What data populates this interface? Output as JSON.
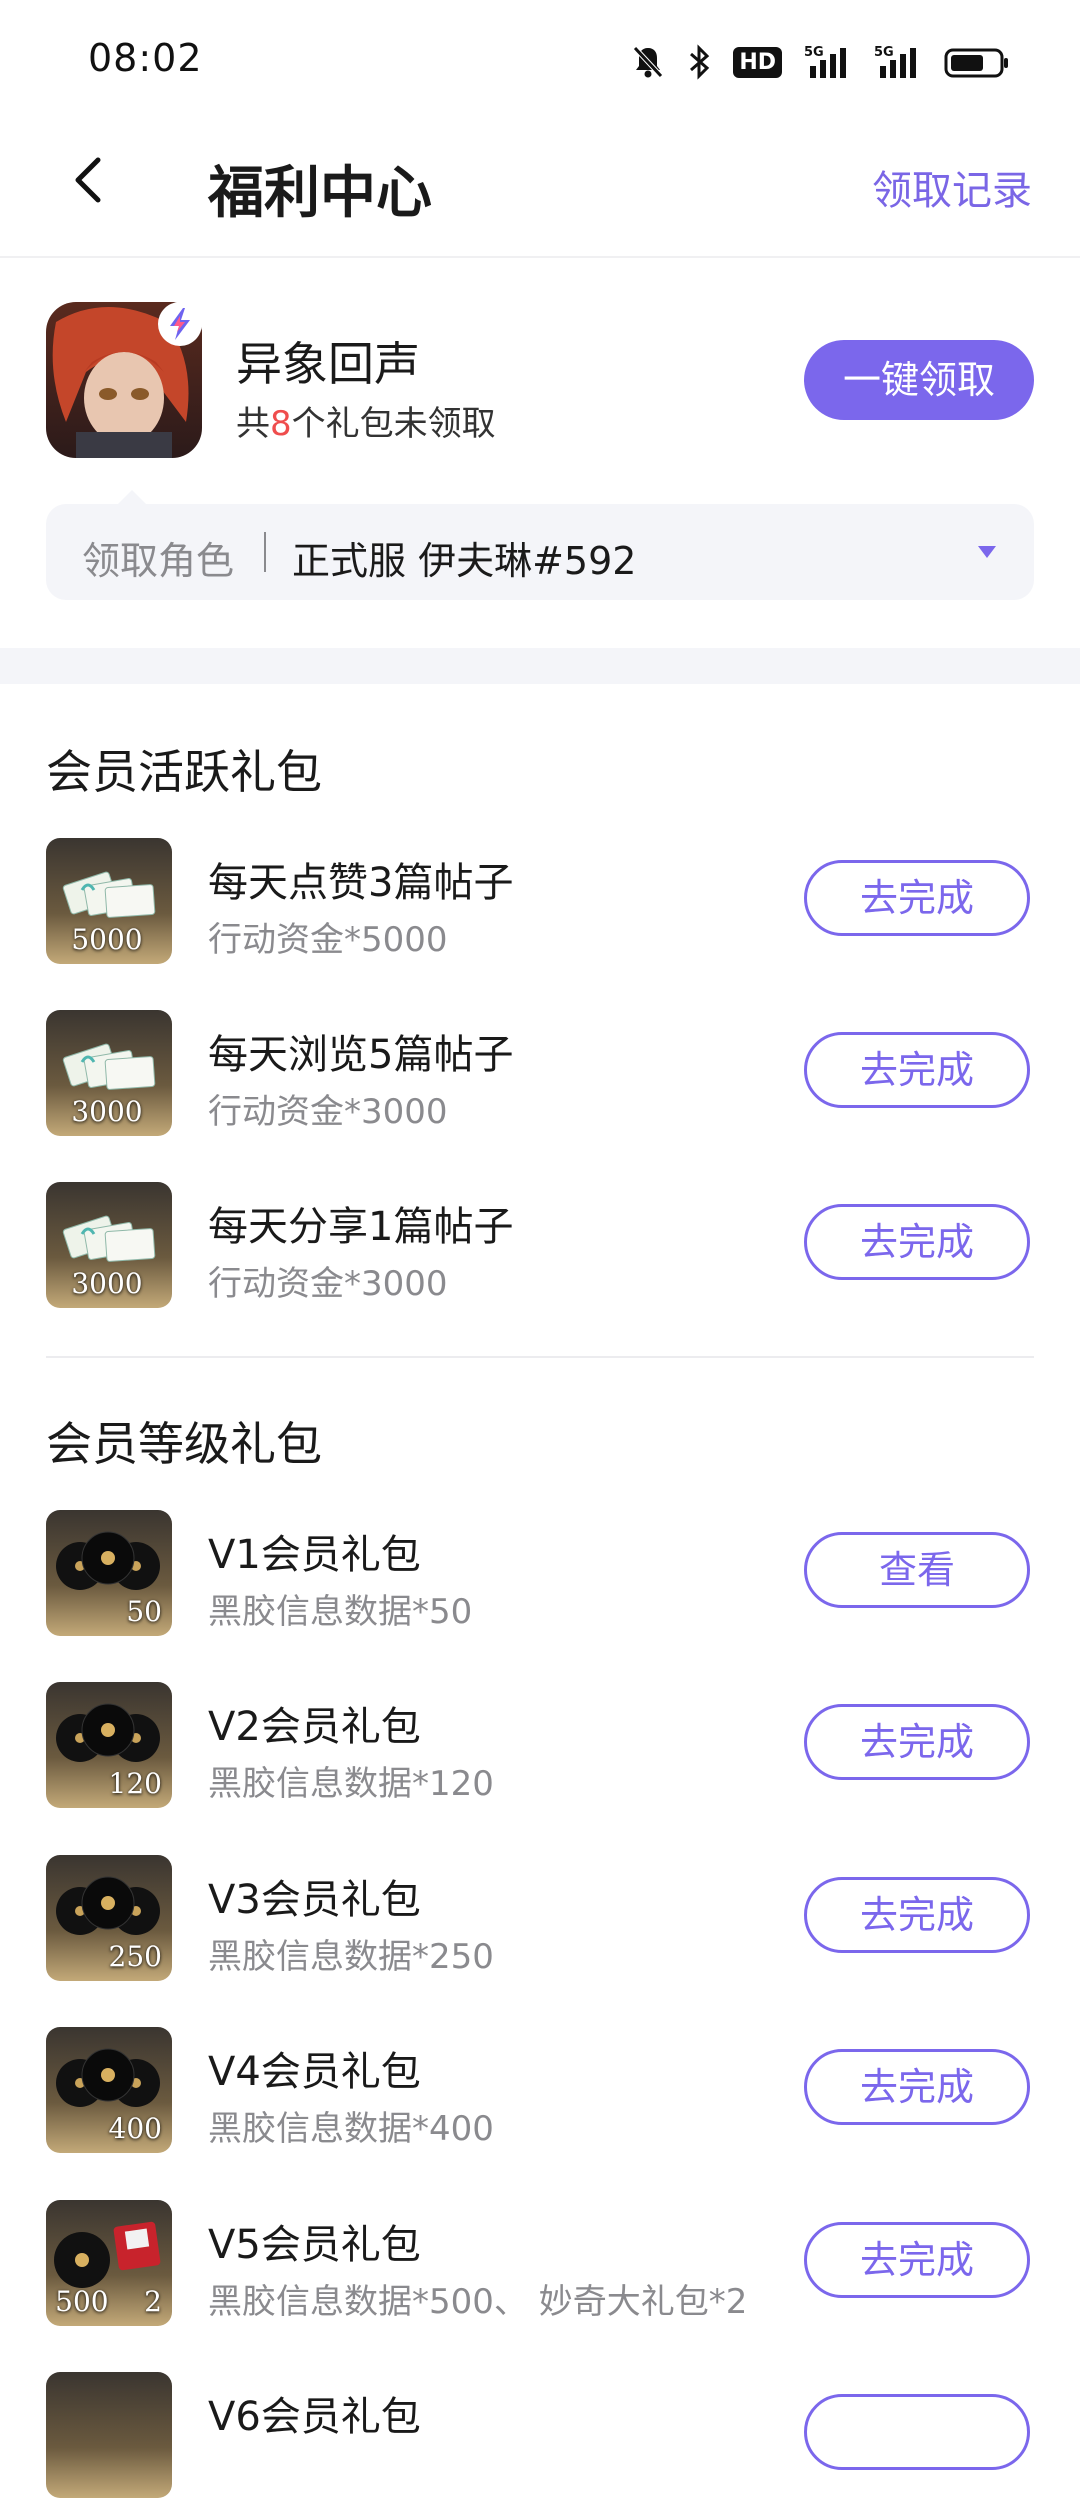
{
  "status": {
    "time": "08:02",
    "hd": "HD",
    "net1": "5G",
    "net2": "5G"
  },
  "nav": {
    "title": "福利中心",
    "link": "领取记录"
  },
  "game": {
    "name": "异象回声",
    "sub_prefix": "共",
    "sub_count": "8",
    "sub_suffix": "个礼包未领取",
    "claim_all": "一键领取"
  },
  "role": {
    "label": "领取角色",
    "value": "正式服 伊夫琳#592"
  },
  "sections": {
    "active": {
      "title": "会员活跃礼包",
      "items": [
        {
          "title": "每天点赞3篇帖子",
          "reward": "行动资金*5000",
          "qty": "5000",
          "button": "去完成"
        },
        {
          "title": "每天浏览5篇帖子",
          "reward": "行动资金*3000",
          "qty": "3000",
          "button": "去完成"
        },
        {
          "title": "每天分享1篇帖子",
          "reward": "行动资金*3000",
          "qty": "3000",
          "button": "去完成"
        }
      ]
    },
    "level": {
      "title": "会员等级礼包",
      "items": [
        {
          "title": "V1会员礼包",
          "reward": "黑胶信息数据*50",
          "qty": "50",
          "button": "查看"
        },
        {
          "title": "V2会员礼包",
          "reward": "黑胶信息数据*120",
          "qty": "120",
          "button": "去完成"
        },
        {
          "title": "V3会员礼包",
          "reward": "黑胶信息数据*250",
          "qty": "250",
          "button": "去完成"
        },
        {
          "title": "V4会员礼包",
          "reward": "黑胶信息数据*400",
          "qty": "400",
          "button": "去完成"
        },
        {
          "title": "V5会员礼包",
          "reward": "黑胶信息数据*500、 妙奇大礼包*2",
          "qty": "500    2",
          "button": "去完成"
        },
        {
          "title": "V6会员礼包",
          "reward": "",
          "qty": "",
          "button": ""
        }
      ]
    }
  },
  "colors": {
    "accent": "#7b67ec",
    "highlight": "#ef4d4d",
    "bg_soft": "#f4f5f9"
  }
}
